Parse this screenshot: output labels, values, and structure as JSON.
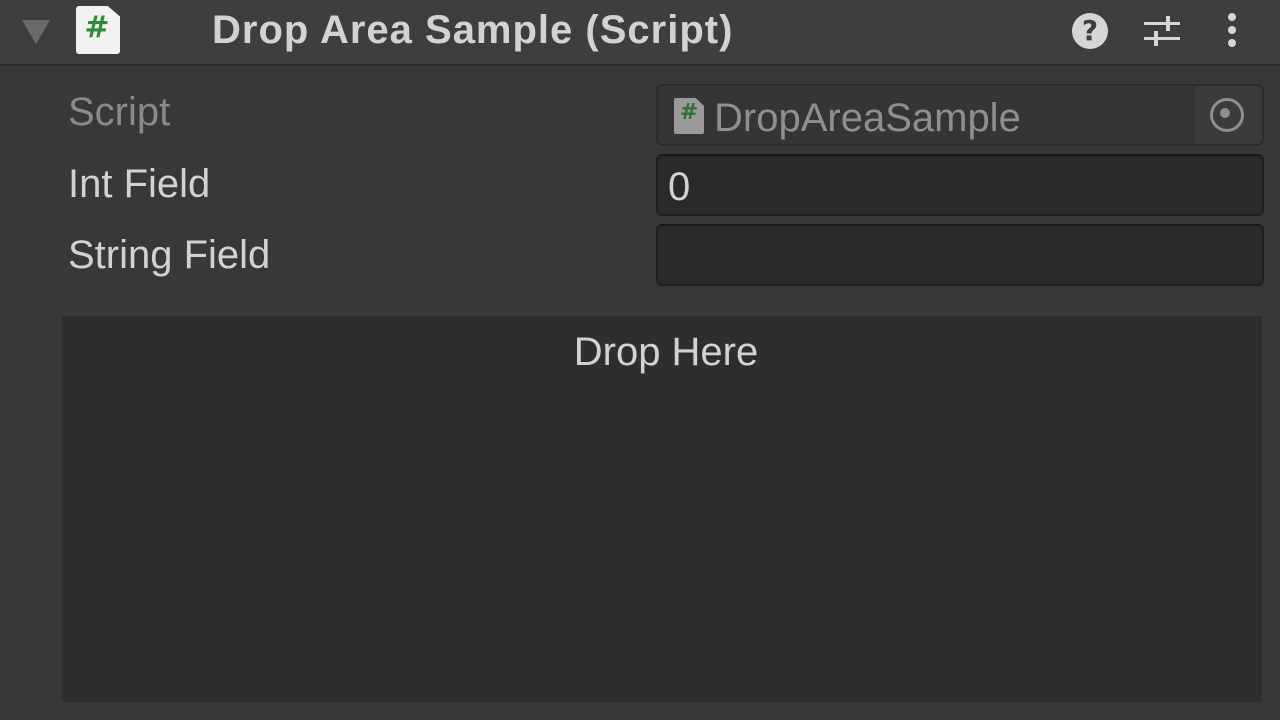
{
  "component": {
    "title": "Drop Area Sample (Script)",
    "icon": "csharp-script-icon",
    "actions": [
      "help-icon",
      "preset-icon",
      "context-menu-icon"
    ]
  },
  "properties": {
    "script": {
      "label": "Script",
      "value": "DropAreaSample",
      "icon": "csharp-script-icon",
      "picker_icon": "object-picker-icon"
    },
    "int_field": {
      "label": "Int Field",
      "value": "0"
    },
    "string_field": {
      "label": "String Field",
      "value": ""
    }
  },
  "drop_area": {
    "label": "Drop Here"
  },
  "colors": {
    "background": "#383838",
    "header": "#3e3e3e",
    "field": "#2a2a2a",
    "drop_area": "#2e2e2e",
    "text": "#d2d2d2",
    "disabled_text": "#8a8a8a",
    "script_hash": "#2f8a3b"
  }
}
